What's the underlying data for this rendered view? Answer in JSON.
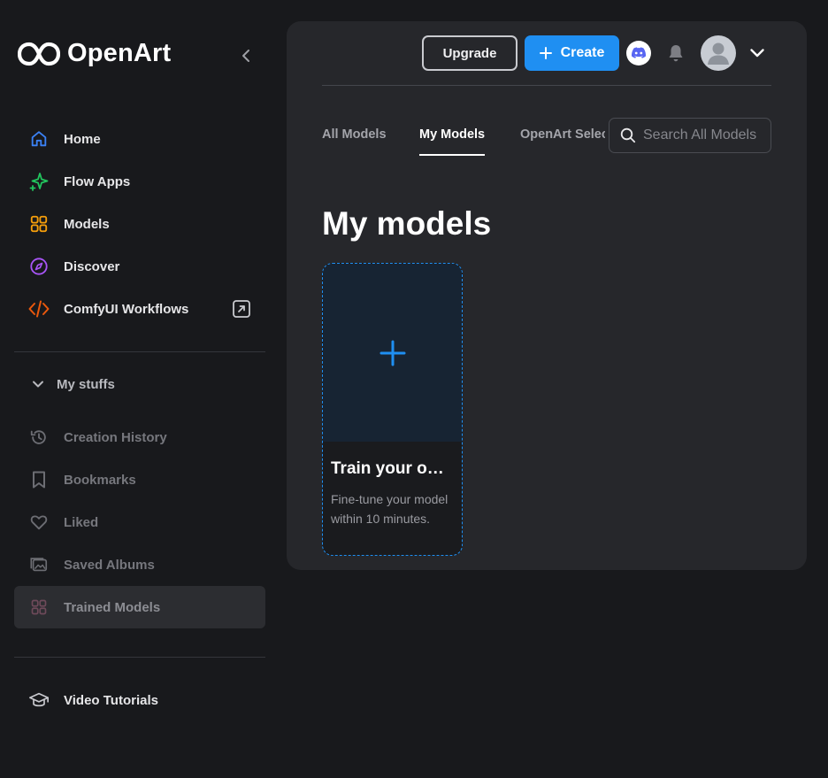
{
  "brand": {
    "name": "OpenArt"
  },
  "nav": [
    {
      "label": "Home",
      "icon": "home-icon",
      "color": "#3b82f6"
    },
    {
      "label": "Flow Apps",
      "icon": "sparkle-icon",
      "color": "#22c55e"
    },
    {
      "label": "Models",
      "icon": "grid-icon",
      "color": "#f59e0b"
    },
    {
      "label": "Discover",
      "icon": "compass-icon",
      "color": "#a855f7"
    },
    {
      "label": "ComfyUI Workflows",
      "icon": "code-icon",
      "color": "#ea580c"
    }
  ],
  "my_stuffs": {
    "label": "My stuffs",
    "items": [
      {
        "label": "Creation History",
        "icon": "history-icon"
      },
      {
        "label": "Bookmarks",
        "icon": "bookmark-icon"
      },
      {
        "label": "Liked",
        "icon": "heart-icon"
      },
      {
        "label": "Saved Albums",
        "icon": "album-icon"
      },
      {
        "label": "Trained Models",
        "icon": "grid-icon",
        "active": true
      }
    ]
  },
  "tutorials": {
    "label": "Video Tutorials",
    "icon": "graduation-cap-icon"
  },
  "header": {
    "upgrade_label": "Upgrade",
    "create_label": "Create",
    "accent": "#1f8ff2"
  },
  "tabs": [
    {
      "label": "All Models"
    },
    {
      "label": "My Models",
      "active": true
    },
    {
      "label": "OpenArt Selects"
    }
  ],
  "search": {
    "placeholder": "Search All Models"
  },
  "main": {
    "title": "My models",
    "card": {
      "title": "Train your own model",
      "description": "Fine-tune your model within 10 minutes."
    }
  }
}
